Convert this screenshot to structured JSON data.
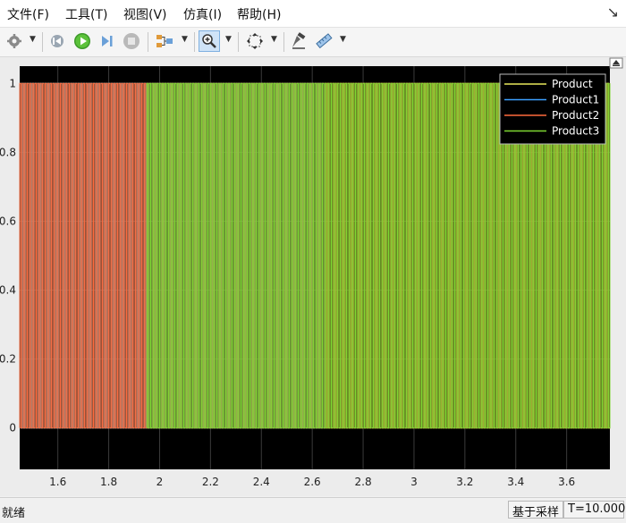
{
  "menu": [
    {
      "label": "文件(F)"
    },
    {
      "label": "工具(T)"
    },
    {
      "label": "视图(V)"
    },
    {
      "label": "仿真(I)"
    },
    {
      "label": "帮助(H)"
    }
  ],
  "menu_caret": "↘",
  "toolbar": {
    "icons": [
      "gear-icon",
      "rewind-icon",
      "play-icon",
      "step-forward-icon",
      "stop-icon",
      "signal-select-icon",
      "zoom-in-icon",
      "fit-to-view-icon",
      "write-data-icon",
      "measure-icon"
    ]
  },
  "status": {
    "state": "就绪",
    "sample_mode": "基于采样",
    "time": "T=10.000"
  },
  "chart_data": {
    "type": "line",
    "title": "",
    "xlabel": "",
    "ylabel": "",
    "xlim": [
      1.45,
      3.77
    ],
    "ylim": [
      -0.12,
      1.05
    ],
    "xticks": [
      1.6,
      1.8,
      2,
      2.2,
      2.4,
      2.6,
      2.8,
      3,
      3.2,
      3.4,
      3.6
    ],
    "xtick_labels": [
      "1.6",
      "1.8",
      "2",
      "2.2",
      "2.4",
      "2.6",
      "2.8",
      "3",
      "3.2",
      "3.4",
      "3.6"
    ],
    "yticks": [
      0,
      0.2,
      0.4,
      0.6,
      0.8,
      1
    ],
    "ytick_labels": [
      "0",
      "0.2",
      "0.4",
      "0.6",
      "0.8",
      "1"
    ],
    "grid": true,
    "background": "#000000",
    "legend_position": "top-right",
    "series": [
      {
        "name": "Product",
        "color": "#e8e85a",
        "x_start": 1.45,
        "x_end": 3.77,
        "low": 0,
        "high": 1,
        "period": 0.01
      },
      {
        "name": "Product1",
        "color": "#3ca0ff",
        "x_start": 1.45,
        "x_end": 2.65,
        "low": 0,
        "high": 1,
        "period": 0.01
      },
      {
        "name": "Product2",
        "color": "#ff6a3c",
        "x_start": 1.45,
        "x_end": 3.77,
        "low": 0,
        "high": 1,
        "period": 0.01
      },
      {
        "name": "Product3",
        "color": "#7ed832",
        "x_start": 1.95,
        "x_end": 3.77,
        "low": 0,
        "high": 1,
        "period": 0.01
      }
    ]
  }
}
